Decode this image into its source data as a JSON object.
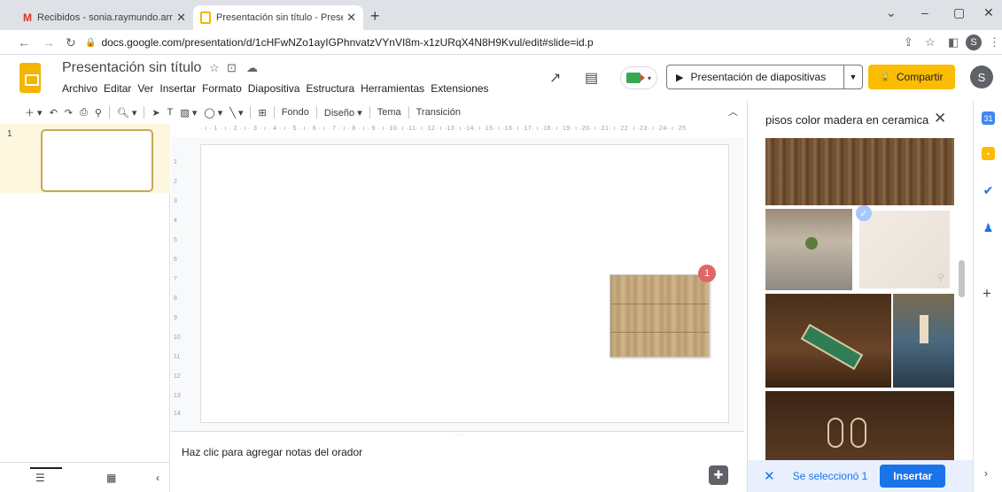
{
  "browser": {
    "tabs": [
      {
        "label": "Recibidos - sonia.raymundo.arr@",
        "icon": "gmail-icon",
        "active": false
      },
      {
        "label": "Presentación sin título - Presenta",
        "icon": "slides-icon",
        "active": true
      }
    ],
    "new_tab": "+",
    "window_controls": {
      "dropdown": "⌄",
      "minimize": "–",
      "restore": "▢",
      "close": "✕"
    },
    "url": "docs.google.com/presentation/d/1cHFwNZo1ayIGPhnvatzVYnVI8m-x1zURqX4N8H9Kvul/edit#slide=id.p",
    "profile_initial": "S"
  },
  "app": {
    "title": "Presentación sin título",
    "menu": [
      "Archivo",
      "Editar",
      "Ver",
      "Insertar",
      "Formato",
      "Diapositiva",
      "Estructura",
      "Herramientas",
      "Extensiones"
    ],
    "present_label": "Presentación de diapositivas",
    "share_label": "Compartir",
    "user_initial": "S",
    "accent": "#fbbc04"
  },
  "toolbar": {
    "fondo": "Fondo",
    "diseno": "Diseño",
    "tema": "Tema",
    "transicion": "Transición"
  },
  "filmstrip": {
    "slide_number": "1"
  },
  "ruler": {
    "h": "· ı · 1 · ı · 2 · ı · 3 · ı · 4 · ı · 5 · ı · 6 · ı · 7 · ı · 8 · ı · 9 · ı ·10· ı ·11· ı ·12· ı ·13· ı ·14· ı ·15· ı ·16· ı ·17· ı ·18· ı ·19· ı ·20· ı ·21· ı ·22· ı ·23· ı ·24· ı ·25",
    "v": [
      "1",
      "2",
      "3",
      "4",
      "5",
      "6",
      "7",
      "8",
      "9",
      "10",
      "11",
      "12",
      "13",
      "14"
    ]
  },
  "slide": {
    "badge": "1"
  },
  "notes": {
    "placeholder": "Haz clic para agregar notas del orador"
  },
  "image_panel": {
    "query": "pisos color madera en ceramica",
    "status": "Se seleccionó 1",
    "insert_label": "Insertar"
  }
}
